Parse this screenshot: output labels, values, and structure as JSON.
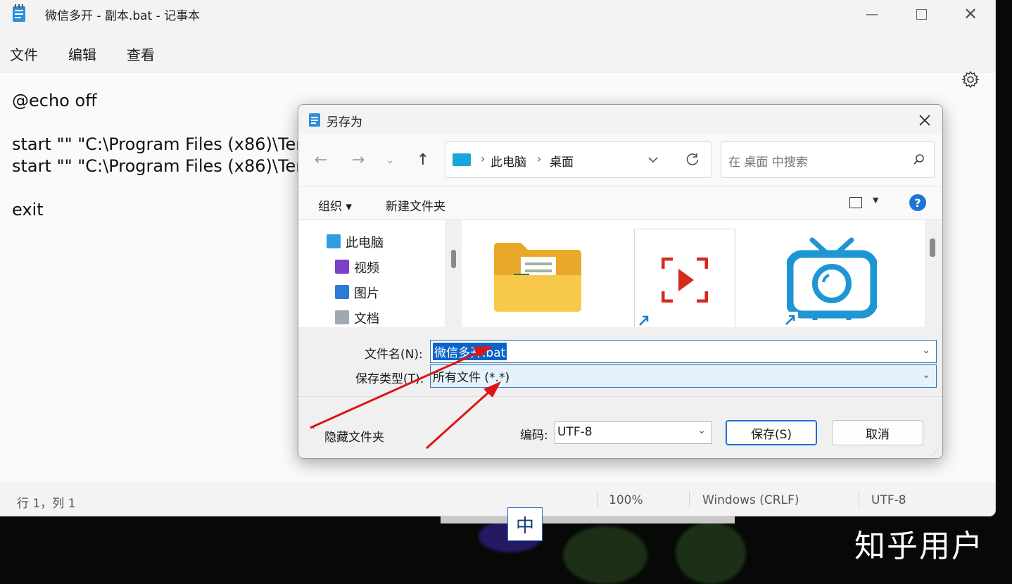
{
  "notepad": {
    "title": "微信多开 - 副本.bat - 记事本",
    "menu": [
      "文件",
      "编辑",
      "查看"
    ],
    "content": "@echo off\n\nstart \"\" \"C:\\Program Files (x86)\\Tenc\nstart \"\" \"C:\\Program Files (x86)\\Tenc\n\nexit",
    "status": {
      "position": "行 1，列 1",
      "zoom": "100%",
      "line_ending": "Windows (CRLF)",
      "encoding": "UTF-8"
    }
  },
  "dialog": {
    "title": "另存为",
    "path": [
      "此电脑",
      "桌面"
    ],
    "search_placeholder": "在 桌面 中搜索",
    "toolbar": {
      "organize": "组织 ▾",
      "new_folder": "新建文件夹"
    },
    "tree": [
      "此电脑",
      "视频",
      "图片",
      "文档"
    ],
    "filename_label": "文件名(N):",
    "filename_value": "微信多开.bat",
    "filetype_label": "保存类型(T):",
    "filetype_value": "所有文件  (*.*)",
    "hide_folders": "隐藏文件夹",
    "encoding_label": "编码:",
    "encoding_value": "UTF-8",
    "save_button": "保存(S)",
    "cancel_button": "取消"
  },
  "ime": "中",
  "watermark": "知乎用户",
  "colors": {
    "accent": "#0a64c8",
    "arrow": "#e01414"
  }
}
